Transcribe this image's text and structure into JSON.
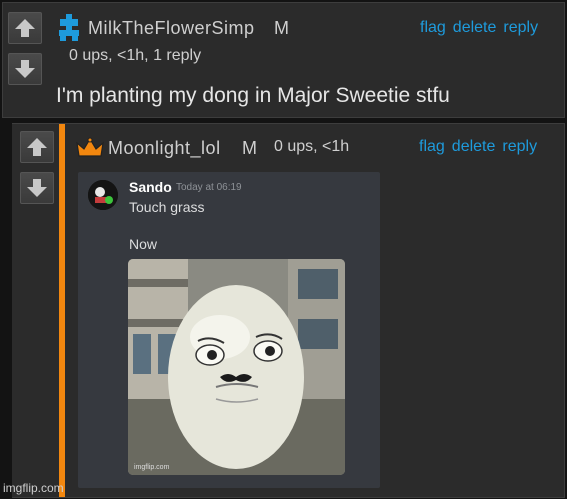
{
  "comments": [
    {
      "username": "MilkTheFlowerSimp",
      "mod_badge": "M",
      "meta": "0 ups, <1h, 1 reply",
      "text": "I'm planting my dong in Major Sweetie stfu",
      "actions": {
        "flag": "flag",
        "delete": "delete",
        "reply": "reply"
      },
      "avatar_icon": "puzzle-piece-icon"
    },
    {
      "username": "Moonlight_lol",
      "mod_badge": "M",
      "meta": "0 ups, <1h",
      "actions": {
        "flag": "flag",
        "delete": "delete",
        "reply": "reply"
      },
      "avatar_icon": "crown-icon",
      "embed": {
        "author": "Sando",
        "timestamp": "Today at 06:19",
        "line1": "Touch grass",
        "line2": "Now",
        "image_watermark": "imgflip.com"
      }
    }
  ],
  "watermark": "imgflip.com",
  "colors": {
    "link": "#1e9bdc",
    "accent_bar": "#f2870f",
    "puzzle_icon": "#1e9bdc"
  }
}
